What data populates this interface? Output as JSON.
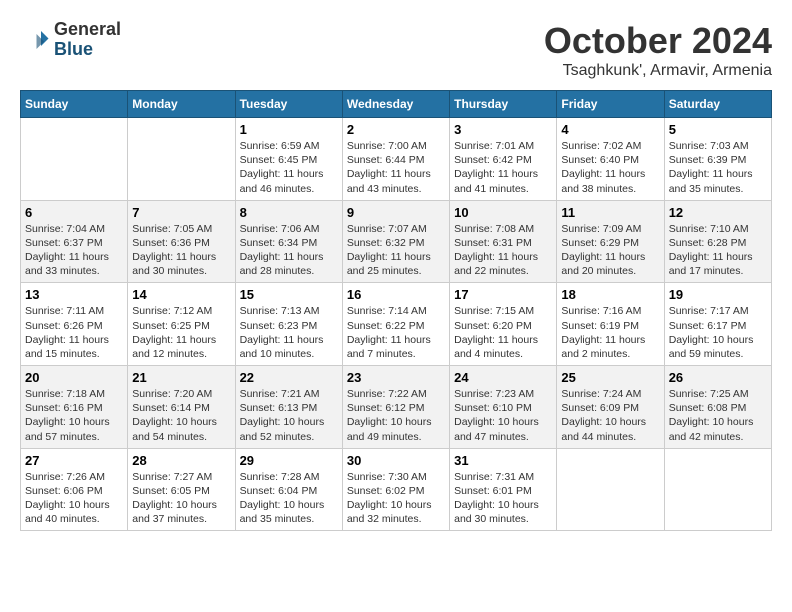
{
  "header": {
    "logo_line1": "General",
    "logo_line2": "Blue",
    "month_title": "October 2024",
    "location": "Tsaghkunk', Armavir, Armenia"
  },
  "calendar": {
    "days_of_week": [
      "Sunday",
      "Monday",
      "Tuesday",
      "Wednesday",
      "Thursday",
      "Friday",
      "Saturday"
    ],
    "weeks": [
      [
        {
          "day": "",
          "info": ""
        },
        {
          "day": "",
          "info": ""
        },
        {
          "day": "1",
          "info": "Sunrise: 6:59 AM\nSunset: 6:45 PM\nDaylight: 11 hours and 46 minutes."
        },
        {
          "day": "2",
          "info": "Sunrise: 7:00 AM\nSunset: 6:44 PM\nDaylight: 11 hours and 43 minutes."
        },
        {
          "day": "3",
          "info": "Sunrise: 7:01 AM\nSunset: 6:42 PM\nDaylight: 11 hours and 41 minutes."
        },
        {
          "day": "4",
          "info": "Sunrise: 7:02 AM\nSunset: 6:40 PM\nDaylight: 11 hours and 38 minutes."
        },
        {
          "day": "5",
          "info": "Sunrise: 7:03 AM\nSunset: 6:39 PM\nDaylight: 11 hours and 35 minutes."
        }
      ],
      [
        {
          "day": "6",
          "info": "Sunrise: 7:04 AM\nSunset: 6:37 PM\nDaylight: 11 hours and 33 minutes."
        },
        {
          "day": "7",
          "info": "Sunrise: 7:05 AM\nSunset: 6:36 PM\nDaylight: 11 hours and 30 minutes."
        },
        {
          "day": "8",
          "info": "Sunrise: 7:06 AM\nSunset: 6:34 PM\nDaylight: 11 hours and 28 minutes."
        },
        {
          "day": "9",
          "info": "Sunrise: 7:07 AM\nSunset: 6:32 PM\nDaylight: 11 hours and 25 minutes."
        },
        {
          "day": "10",
          "info": "Sunrise: 7:08 AM\nSunset: 6:31 PM\nDaylight: 11 hours and 22 minutes."
        },
        {
          "day": "11",
          "info": "Sunrise: 7:09 AM\nSunset: 6:29 PM\nDaylight: 11 hours and 20 minutes."
        },
        {
          "day": "12",
          "info": "Sunrise: 7:10 AM\nSunset: 6:28 PM\nDaylight: 11 hours and 17 minutes."
        }
      ],
      [
        {
          "day": "13",
          "info": "Sunrise: 7:11 AM\nSunset: 6:26 PM\nDaylight: 11 hours and 15 minutes."
        },
        {
          "day": "14",
          "info": "Sunrise: 7:12 AM\nSunset: 6:25 PM\nDaylight: 11 hours and 12 minutes."
        },
        {
          "day": "15",
          "info": "Sunrise: 7:13 AM\nSunset: 6:23 PM\nDaylight: 11 hours and 10 minutes."
        },
        {
          "day": "16",
          "info": "Sunrise: 7:14 AM\nSunset: 6:22 PM\nDaylight: 11 hours and 7 minutes."
        },
        {
          "day": "17",
          "info": "Sunrise: 7:15 AM\nSunset: 6:20 PM\nDaylight: 11 hours and 4 minutes."
        },
        {
          "day": "18",
          "info": "Sunrise: 7:16 AM\nSunset: 6:19 PM\nDaylight: 11 hours and 2 minutes."
        },
        {
          "day": "19",
          "info": "Sunrise: 7:17 AM\nSunset: 6:17 PM\nDaylight: 10 hours and 59 minutes."
        }
      ],
      [
        {
          "day": "20",
          "info": "Sunrise: 7:18 AM\nSunset: 6:16 PM\nDaylight: 10 hours and 57 minutes."
        },
        {
          "day": "21",
          "info": "Sunrise: 7:20 AM\nSunset: 6:14 PM\nDaylight: 10 hours and 54 minutes."
        },
        {
          "day": "22",
          "info": "Sunrise: 7:21 AM\nSunset: 6:13 PM\nDaylight: 10 hours and 52 minutes."
        },
        {
          "day": "23",
          "info": "Sunrise: 7:22 AM\nSunset: 6:12 PM\nDaylight: 10 hours and 49 minutes."
        },
        {
          "day": "24",
          "info": "Sunrise: 7:23 AM\nSunset: 6:10 PM\nDaylight: 10 hours and 47 minutes."
        },
        {
          "day": "25",
          "info": "Sunrise: 7:24 AM\nSunset: 6:09 PM\nDaylight: 10 hours and 44 minutes."
        },
        {
          "day": "26",
          "info": "Sunrise: 7:25 AM\nSunset: 6:08 PM\nDaylight: 10 hours and 42 minutes."
        }
      ],
      [
        {
          "day": "27",
          "info": "Sunrise: 7:26 AM\nSunset: 6:06 PM\nDaylight: 10 hours and 40 minutes."
        },
        {
          "day": "28",
          "info": "Sunrise: 7:27 AM\nSunset: 6:05 PM\nDaylight: 10 hours and 37 minutes."
        },
        {
          "day": "29",
          "info": "Sunrise: 7:28 AM\nSunset: 6:04 PM\nDaylight: 10 hours and 35 minutes."
        },
        {
          "day": "30",
          "info": "Sunrise: 7:30 AM\nSunset: 6:02 PM\nDaylight: 10 hours and 32 minutes."
        },
        {
          "day": "31",
          "info": "Sunrise: 7:31 AM\nSunset: 6:01 PM\nDaylight: 10 hours and 30 minutes."
        },
        {
          "day": "",
          "info": ""
        },
        {
          "day": "",
          "info": ""
        }
      ]
    ]
  }
}
